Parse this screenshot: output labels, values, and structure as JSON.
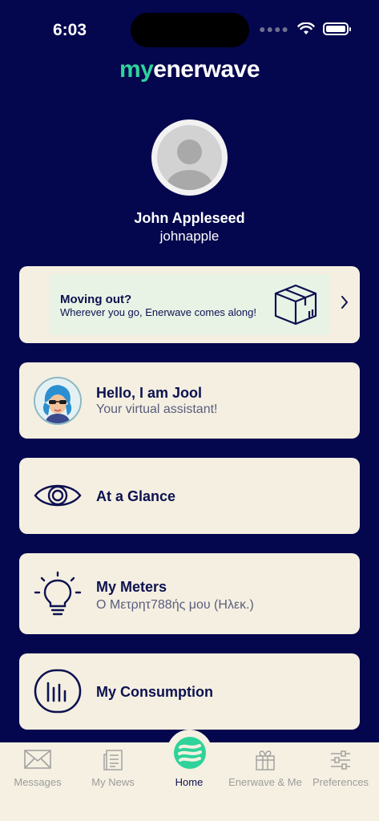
{
  "status": {
    "time": "6:03"
  },
  "logo": {
    "my": "my",
    "rest": "enerwave"
  },
  "profile": {
    "name": "John Appleseed",
    "username": "johnapple"
  },
  "banner": {
    "title": "Moving out?",
    "subtitle": "Wherever you go, Enerwave comes along!",
    "icon": "box-icon"
  },
  "cards": {
    "assistant": {
      "title": "Hello, I am Jool",
      "subtitle": "Your virtual assistant!"
    },
    "glance": {
      "title": "At a Glance"
    },
    "meters": {
      "title": "My Meters",
      "subtitle": "Ο Μετρητ788ής μου (Ηλεκ.)"
    },
    "consumption": {
      "title": "My Consumption"
    }
  },
  "tabs": [
    {
      "label": "Messages",
      "icon": "envelope-icon"
    },
    {
      "label": "My News",
      "icon": "newspaper-icon"
    },
    {
      "label": "Home",
      "icon": "enerwave-logo-icon",
      "active": true
    },
    {
      "label": "Enerwave & Me",
      "icon": "gift-icon"
    },
    {
      "label": "Preferences",
      "icon": "sliders-icon"
    }
  ],
  "colors": {
    "background": "#04064e",
    "card": "#f4efe1",
    "accent": "#2ed39a",
    "text": "#0d1150"
  }
}
